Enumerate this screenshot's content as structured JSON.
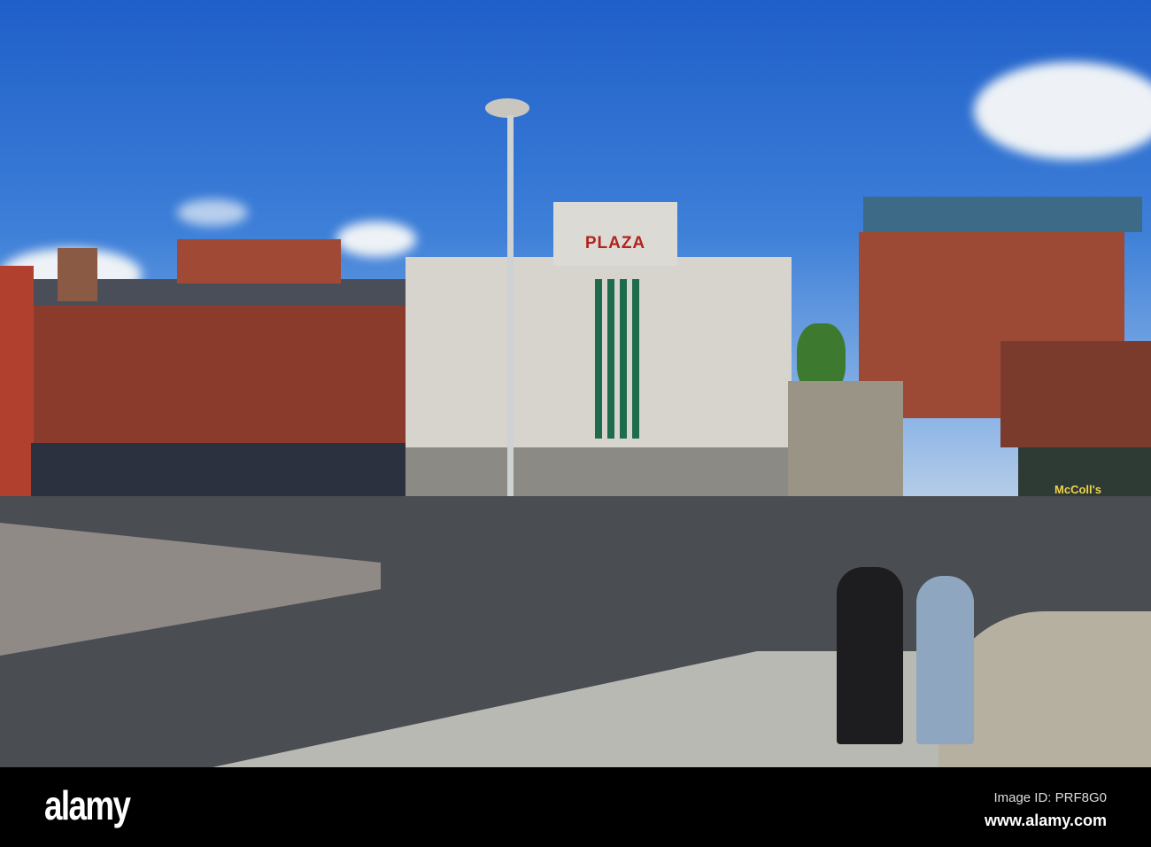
{
  "photo": {
    "signs": {
      "cinema": "PLAZA",
      "shop": "McColl's"
    },
    "colors": {
      "sky": "#2f6fd0",
      "brick": "#8a3a2a",
      "cinema": "#d8d6d0",
      "road": "#3b3e42"
    }
  },
  "watermark": {
    "logo": "alamy",
    "image_id": "Image ID: PRF8G0",
    "url": "www.alamy.com"
  }
}
